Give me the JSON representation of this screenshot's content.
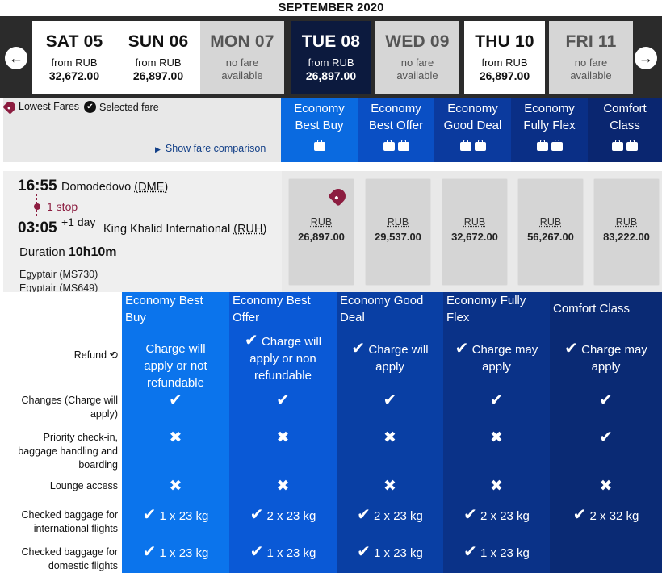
{
  "month_title": "SEPTEMBER 2020",
  "nav": {
    "prev_icon": "chevron-left-icon",
    "next_icon": "chevron-right-icon",
    "prev_glyph": "←",
    "next_glyph": "→"
  },
  "days": [
    {
      "label": "SAT 05",
      "line1": "from RUB",
      "line2": "32,672.00",
      "state": "available"
    },
    {
      "label": "SUN 06",
      "line1": "from RUB",
      "line2": "26,897.00",
      "state": "available"
    },
    {
      "label": "MON 07",
      "line1": "no fare",
      "line2": "available",
      "state": "nofare"
    },
    {
      "label": "TUE 08",
      "line1": "from RUB",
      "line2": "26,897.00",
      "state": "selected"
    },
    {
      "label": "WED 09",
      "line1": "no fare",
      "line2": "available",
      "state": "nofare"
    },
    {
      "label": "THU 10",
      "line1": "from RUB",
      "line2": "26,897.00",
      "state": "available"
    },
    {
      "label": "FRI 11",
      "line1": "no fare",
      "line2": "available",
      "state": "nofare"
    }
  ],
  "legend": {
    "lowest": "Lowest Fares",
    "selected": "Selected fare",
    "compare": "Show fare comparison",
    "check_glyph": "✔"
  },
  "fare_headers": [
    {
      "name": "Economy Best Buy",
      "line1": "Economy",
      "line2": "Best Buy",
      "bags": 1,
      "color": "#0a6ae0"
    },
    {
      "name": "Economy Best Offer",
      "line1": "Economy",
      "line2": "Best Offer",
      "bags": 2,
      "color": "#0a4fc4"
    },
    {
      "name": "Economy Good Deal",
      "line1": "Economy",
      "line2": "Good Deal",
      "bags": 2,
      "color": "#0b3a9e"
    },
    {
      "name": "Economy Fully Flex",
      "line1": "Economy",
      "line2": "Fully Flex",
      "bags": 2,
      "color": "#0a2f86"
    },
    {
      "name": "Comfort Class",
      "line1": "Comfort",
      "line2": "Class",
      "bags": 2,
      "color": "#0a2670"
    }
  ],
  "flight": {
    "dep_time": "16:55",
    "dep_place": "Domodedovo",
    "dep_code": "(DME)",
    "stops": "1 stop",
    "arr_time": "03:05",
    "arr_plus": "+1 day",
    "arr_place": "King Khalid International",
    "arr_code": "(RUH)",
    "duration_label": "Duration",
    "duration_value": "10h10m",
    "carriers": [
      "Egyptair (MS730)",
      "Egyptair (MS649)"
    ]
  },
  "fare_prices": [
    {
      "currency": "RUB",
      "amount": "26,897.00",
      "lowest": true
    },
    {
      "currency": "RUB",
      "amount": "29,537.00",
      "lowest": false
    },
    {
      "currency": "RUB",
      "amount": "32,672.00",
      "lowest": false
    },
    {
      "currency": "RUB",
      "amount": "56,267.00",
      "lowest": false
    },
    {
      "currency": "RUB",
      "amount": "83,222.00",
      "lowest": false
    }
  ],
  "comparison": {
    "columns": [
      {
        "title": "Economy Best Buy",
        "color": "#0b74ec"
      },
      {
        "title": "Economy Best Offer",
        "color": "#0a59d6"
      },
      {
        "title": "Economy Good Deal",
        "color": "#093fa4"
      },
      {
        "title": "Economy Fully Flex",
        "color": "#0a3288"
      },
      {
        "title": "Comfort Class",
        "color": "#0a2a74"
      }
    ],
    "rows": [
      {
        "label": "Refund",
        "cells": [
          {
            "icon": "",
            "text": "Charge will apply or not refundable"
          },
          {
            "icon": "✔",
            "text": "Charge will apply or non refundable"
          },
          {
            "icon": "✔",
            "text": "Charge will apply"
          },
          {
            "icon": "✔",
            "text": "Charge may apply"
          },
          {
            "icon": "✔",
            "text": "Charge may apply"
          }
        ]
      },
      {
        "label": "Changes (Charge will apply)",
        "cells": [
          {
            "icon": "✔",
            "text": ""
          },
          {
            "icon": "✔",
            "text": ""
          },
          {
            "icon": "✔",
            "text": ""
          },
          {
            "icon": "✔",
            "text": ""
          },
          {
            "icon": "✔",
            "text": ""
          }
        ]
      },
      {
        "label": "Priority check-in, baggage handling and boarding",
        "cells": [
          {
            "icon": "✖",
            "text": ""
          },
          {
            "icon": "✖",
            "text": ""
          },
          {
            "icon": "✖",
            "text": ""
          },
          {
            "icon": "✖",
            "text": ""
          },
          {
            "icon": "✔",
            "text": ""
          }
        ]
      },
      {
        "label": "Lounge access",
        "cells": [
          {
            "icon": "✖",
            "text": ""
          },
          {
            "icon": "✖",
            "text": ""
          },
          {
            "icon": "✖",
            "text": ""
          },
          {
            "icon": "✖",
            "text": ""
          },
          {
            "icon": "✖",
            "text": ""
          }
        ]
      },
      {
        "label": "Checked baggage for international flights",
        "cells": [
          {
            "icon": "✔",
            "text": "1 x 23 kg"
          },
          {
            "icon": "✔",
            "text": "2 x 23 kg"
          },
          {
            "icon": "✔",
            "text": "2 x 23 kg"
          },
          {
            "icon": "✔",
            "text": "2 x 23 kg"
          },
          {
            "icon": "✔",
            "text": "2 x 32 kg"
          }
        ]
      },
      {
        "label": "Checked baggage for domestic flights",
        "cells": [
          {
            "icon": "✔",
            "text": "1 x 23 kg"
          },
          {
            "icon": "✔",
            "text": "1 x 23 kg"
          },
          {
            "icon": "✔",
            "text": "1 x 23 kg"
          },
          {
            "icon": "✔",
            "text": "1 x 23 kg"
          },
          {
            "icon": "",
            "text": ""
          }
        ]
      }
    ]
  }
}
